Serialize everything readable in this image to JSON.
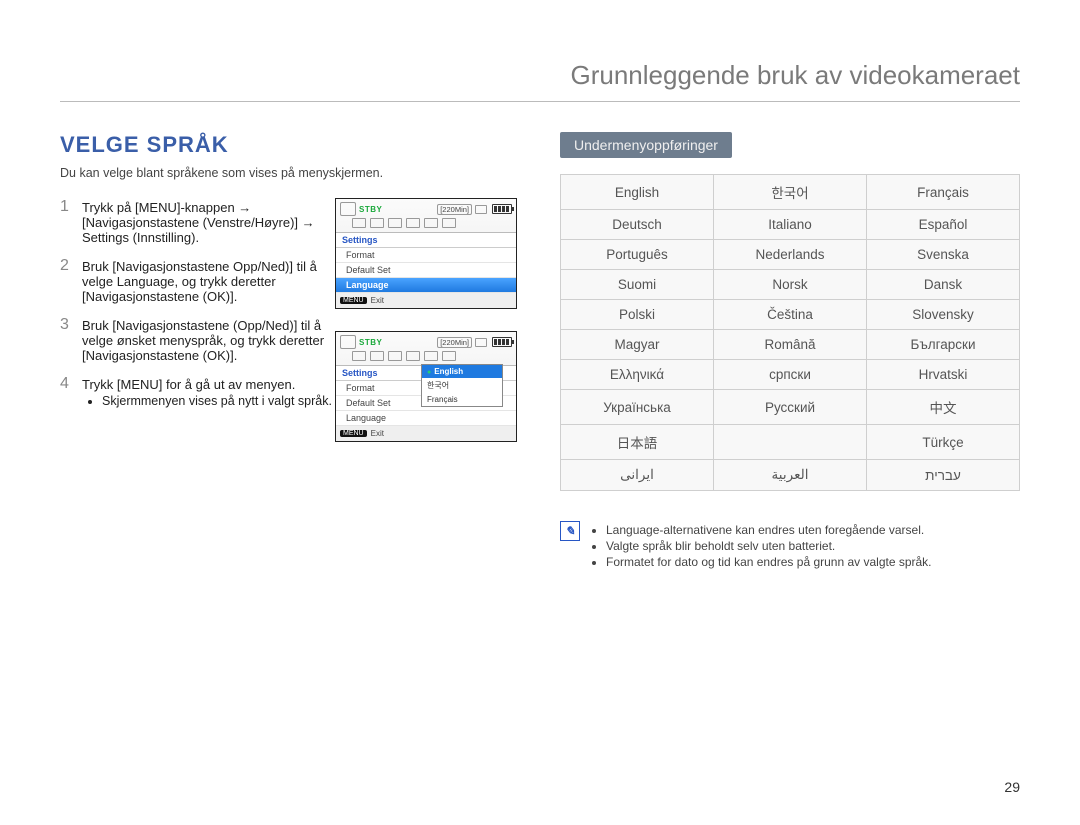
{
  "chapterTitle": "Grunnleggende bruk av videokameraet",
  "sectionTitle": "VELGE SPRÅK",
  "intro": "Du kan velge blant språkene som vises på menyskjermen.",
  "steps": [
    "Trykk på [MENU]-knappen → [Navigasjonstastene (Venstre/Høyre)] → Settings (Innstilling).",
    "Bruk [Navigasjonstastene Opp/Ned)] til å velge Language, og trykk deretter [Navigasjonstastene (OK)].",
    "Bruk [Navigasjonstastene (Opp/Ned)] til å velge ønsket menyspråk, og trykk deretter [Navigasjonstastene (OK)].",
    "Trykk [MENU] for å gå ut av menyen."
  ],
  "step4bullet": "Skjermmenyen vises på nytt i valgt språk.",
  "submenuLabel": "Undermenyoppføringer",
  "langTable": [
    [
      "English",
      "한국어",
      "Français"
    ],
    [
      "Deutsch",
      "Italiano",
      "Español"
    ],
    [
      "Português",
      "Nederlands",
      "Svenska"
    ],
    [
      "Suomi",
      "Norsk",
      "Dansk"
    ],
    [
      "Polski",
      "Čeština",
      "Slovensky"
    ],
    [
      "Magyar",
      "Română",
      "Български"
    ],
    [
      "Ελληνικά",
      "српски",
      "Hrvatski"
    ],
    [
      "Українська",
      "Русский",
      "中文"
    ],
    [
      "日本語",
      "",
      "Türkçe"
    ],
    [
      "ایرانی",
      "العربیة",
      "עברית"
    ]
  ],
  "notes": [
    "Language-alternativene kan endres uten foregående varsel.",
    "Valgte språk blir beholdt selv uten batteriet.",
    "Formatet for dato og tid kan endres på grunn av valgte språk."
  ],
  "pageNumber": "29",
  "lcd": {
    "stby": "STBY",
    "time": "[220Min]",
    "settingsHeader": "Settings",
    "items1": [
      "Format",
      "Default Set",
      "Language"
    ],
    "exitKey": "MENU",
    "exitLabel": "Exit",
    "dropdown": [
      "English",
      "한국어",
      "Français"
    ]
  }
}
